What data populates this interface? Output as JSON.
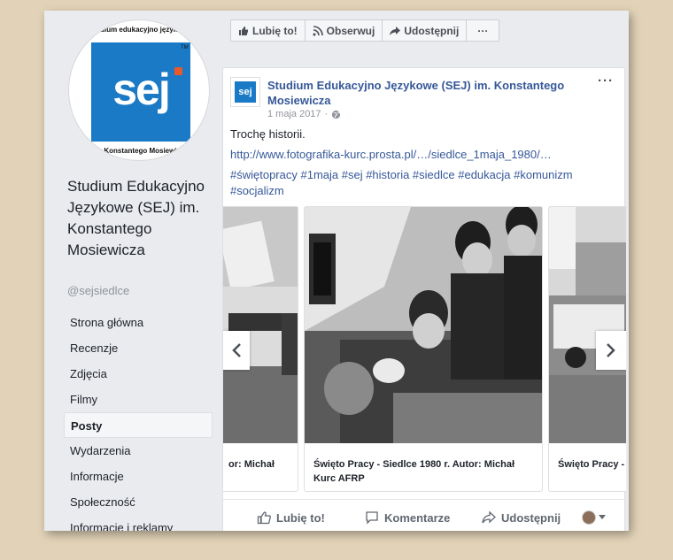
{
  "sidebar": {
    "logo": {
      "top_text": "Studium edukacyjno językowe",
      "sej": "sej",
      "tm": "TM",
      "bottom_text": "im. Konstantego Mosiewicza"
    },
    "page_name": "Studium Edukacyjno Językowe (SEJ) im. Konstantego Mosiewicza",
    "handle": "@sejsiedlce",
    "nav": [
      "Strona główna",
      "Recenzje",
      "Zdjęcia",
      "Filmy",
      "Posty",
      "Wydarzenia",
      "Informacje",
      "Społeczność",
      "Informacje i reklamy"
    ],
    "active_nav": "Posty"
  },
  "actionbar": {
    "like": "Lubię to!",
    "follow": "Obserwuj",
    "share": "Udostępnij",
    "more": "···"
  },
  "post": {
    "avatar_text": "sej",
    "author": "Studium Edukacyjno Językowe (SEJ) im. Konstantego Mosiewicza",
    "date": "1 maja 2017",
    "more": "···",
    "text": "Trochę historii.",
    "link": "http://www.fotografika-kurc.prosta.pl/…/siedlce_1maja_1980/…",
    "hashtags": "#świętopracy #1maja #sej #historia #siedlce #edukacja #komunizm #socjalizm",
    "cards": [
      {
        "caption": "or: Michał"
      },
      {
        "caption": "Święto Pracy - Siedlce 1980 r. Autor: Michał Kurc AFRP"
      },
      {
        "caption": "Święto Pracy - Kurc AFRP"
      }
    ],
    "footer": {
      "like": "Lubię to!",
      "comment": "Komentarze",
      "share": "Udostępnij"
    }
  },
  "colors": {
    "brand_blue": "#1a7ac6",
    "link_blue": "#365899",
    "logo_orange": "#e8582a"
  }
}
